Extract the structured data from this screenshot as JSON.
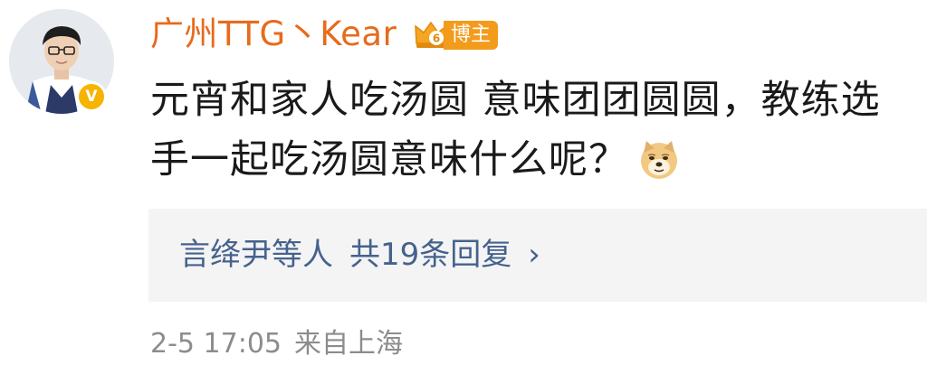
{
  "user": {
    "name": "广州TTG丶Kear",
    "badge_label": "博主",
    "crown_level": "6",
    "verified_mark": "V"
  },
  "post": {
    "lines": [
      "元宵和家人吃汤圆 意味团团圆圆，教练选",
      "手一起吃汤圆意味什么呢？"
    ],
    "emoji": "doge-emoji"
  },
  "replies": {
    "names": "言绛尹等人",
    "count_text": "共19条回复",
    "chevron": "›"
  },
  "meta": {
    "timestamp": "2-5 17:05",
    "location": "来自上海"
  },
  "colors": {
    "username": "#e86a1c",
    "badge": "#f39b1b",
    "verified": "#f6b400",
    "reply_link": "#45628e",
    "reply_bg": "#f4f4f4",
    "meta": "#8c8c8c"
  }
}
